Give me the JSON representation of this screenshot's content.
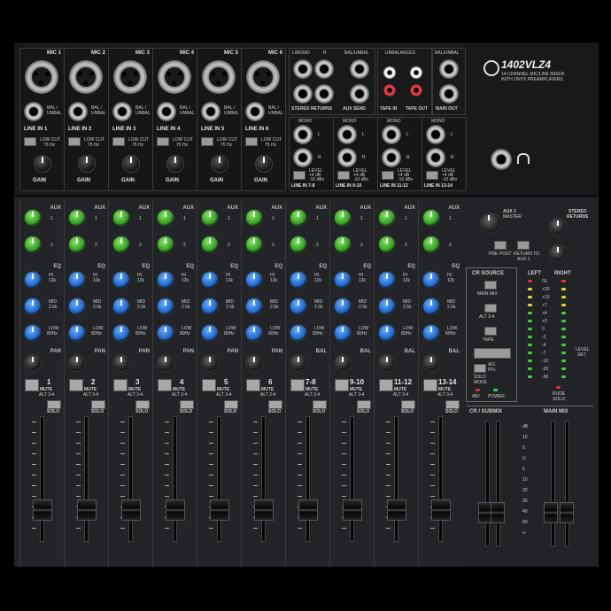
{
  "brand": {
    "model": "1402VLZ4",
    "tagline_1": "14-CHANNEL MIC/LINE MIXER",
    "tagline_2": "WITH ONYX PREAMPLIFIERS"
  },
  "mic_inputs": [
    {
      "label": "MIC 1",
      "line": "LINE IN 1"
    },
    {
      "label": "MIC 2",
      "line": "LINE IN 2"
    },
    {
      "label": "MIC 3",
      "line": "LINE IN 3"
    },
    {
      "label": "MIC 4",
      "line": "LINE IN 4"
    },
    {
      "label": "MIC 5",
      "line": "LINE IN 5"
    },
    {
      "label": "MIC 6",
      "line": "LINE IN 6"
    }
  ],
  "mic_col_text": {
    "bal": "BAL /",
    "unbal": "UNBAL",
    "low_cut": "LOW CUT",
    "low_cut_freq": "75 Hz",
    "gain": "GAIN"
  },
  "stereo_inputs": [
    {
      "label": "LINE IN 7-8"
    },
    {
      "label": "LINE IN 9-10"
    },
    {
      "label": "LINE IN 11-12"
    },
    {
      "label": "LINE IN 13-14"
    }
  ],
  "stereo_text": {
    "mono": "MONO",
    "l": "L",
    "r": "R",
    "level": "LEVEL",
    "level_a": "+4 dB",
    "level_b": "-10 dBv"
  },
  "rear_sections": {
    "l_mono": "L/MONO",
    "r": "R",
    "bal_unbal": "BAL/UNBAL",
    "unbalanced": "UNBALANCED",
    "stereo_returns": "STEREO RETURNS",
    "aux_send": "AUX SEND",
    "tape_in": "TAPE IN",
    "tape_out": "TAPE OUT",
    "main_out": "MAIN OUT"
  },
  "channels": [
    {
      "number": "1",
      "type": "mono"
    },
    {
      "number": "2",
      "type": "mono"
    },
    {
      "number": "3",
      "type": "mono"
    },
    {
      "number": "4",
      "type": "mono"
    },
    {
      "number": "5",
      "type": "mono"
    },
    {
      "number": "6",
      "type": "mono"
    },
    {
      "number": "7-8",
      "type": "stereo"
    },
    {
      "number": "9-10",
      "type": "stereo"
    },
    {
      "number": "11-12",
      "type": "stereo"
    },
    {
      "number": "13-14",
      "type": "stereo"
    }
  ],
  "channel_text": {
    "aux": "AUX",
    "aux1": "1",
    "aux2": "2",
    "eq": "EQ",
    "hi": "HI",
    "hi_freq": "12k",
    "mid": "MID",
    "mid_freq": "2.5k",
    "low": "LOW",
    "low_freq": "80Hz",
    "pan": "PAN",
    "bal": "BAL",
    "mute": "MUTE",
    "alt": "ALT 3-4",
    "solo": "SOLO"
  },
  "master": {
    "aux1_master": "AUX 1",
    "aux1_master_sub": "MASTER",
    "stereo_returns": "STEREO",
    "stereo_returns_2": "RETURNS",
    "pre_post": "PRE",
    "pre_post_2": "POST",
    "return_to": "RETURN TO",
    "return_to_2": "AUX 1",
    "cr_source": "CR SOURCE",
    "main_mix": "MAIN MIX",
    "alt34": "ALT 3-4",
    "tape": "TAPE",
    "solo_mode": "SOLO",
    "solo_mode_2": "MODE",
    "afl": "AFL",
    "pfl": "PFL",
    "v48": "48V",
    "power": "POWER",
    "rude_solo": "RUDE",
    "rude_solo_2": "SOLO",
    "left": "LEFT",
    "right": "RIGHT",
    "level_set": "LEVEL",
    "level_set_2": "SET",
    "cr_submix": "CR / SUBMIX",
    "main_mix_fader": "MAIN MIX"
  },
  "meter_labels": [
    "OL",
    "+20",
    "+10",
    "+7",
    "+4",
    "+2",
    "0",
    "-2",
    "-4",
    "-7",
    "-10",
    "-20",
    "-30"
  ],
  "fader_scale": [
    "dB",
    "10",
    "5",
    "U",
    "5",
    "10",
    "20",
    "30",
    "40",
    "60",
    "∞"
  ],
  "colors": {
    "aux_knob": "#2f9a1f",
    "eq_knob": "#1c62c4",
    "meter_green": "#3ad03a",
    "meter_yellow": "#e0d030",
    "meter_red": "#e03030"
  }
}
